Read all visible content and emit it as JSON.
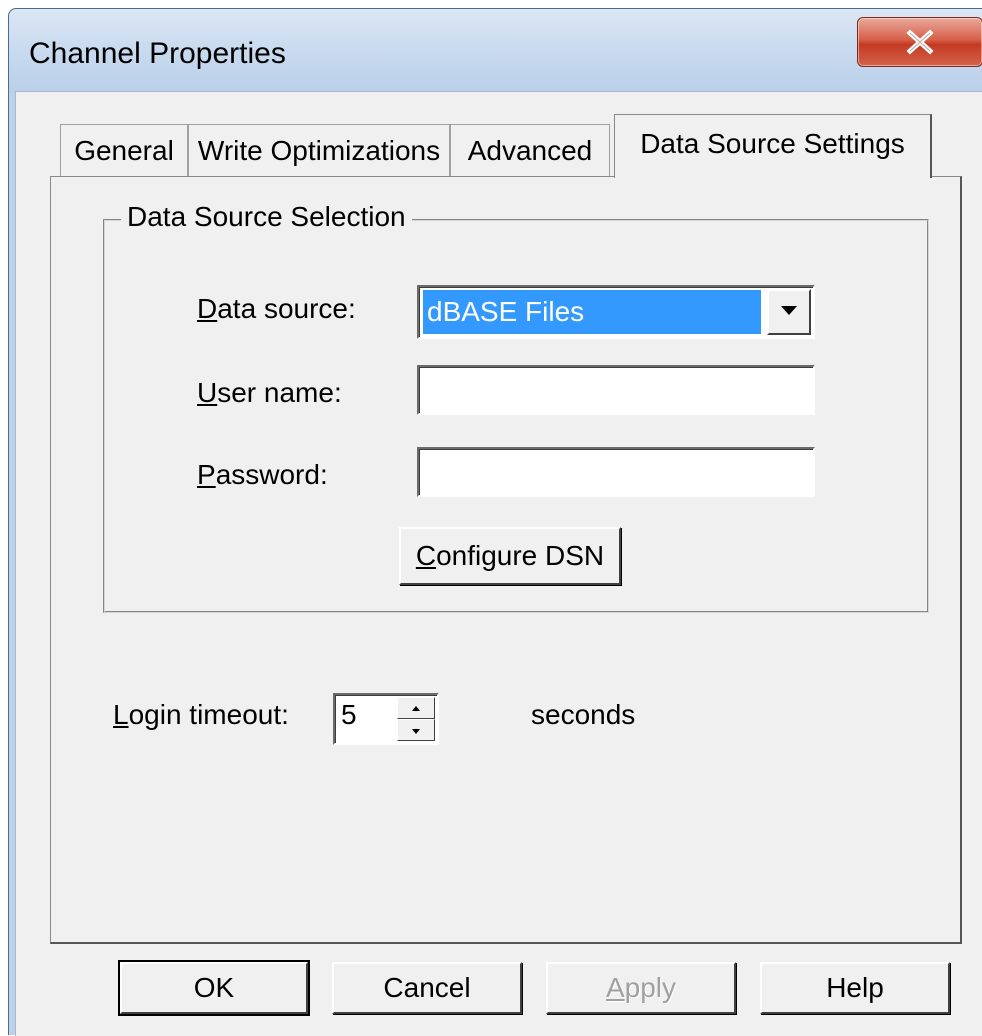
{
  "window": {
    "title": "Channel Properties",
    "close_glyph": "X"
  },
  "tabs": [
    {
      "label": "General",
      "active": false
    },
    {
      "label": "Write Optimizations",
      "active": false
    },
    {
      "label": "Advanced",
      "active": false
    },
    {
      "label": "Data Source Settings",
      "active": true
    }
  ],
  "group": {
    "legend": "Data Source Selection",
    "data_source": {
      "mnemonic": "D",
      "label_rest": "ata source:",
      "value": "dBASE Files"
    },
    "user_name": {
      "mnemonic": "U",
      "label_rest": "ser name:",
      "value": ""
    },
    "password": {
      "mnemonic": "P",
      "label_rest": "assword:",
      "value": ""
    },
    "configure": {
      "mnemonic": "C",
      "label_rest": "onfigure DSN"
    }
  },
  "login_timeout": {
    "mnemonic": "L",
    "label_rest": "ogin timeout:",
    "value": "5",
    "unit": "seconds"
  },
  "buttons": {
    "ok": "OK",
    "cancel": "Cancel",
    "apply_mnemonic": "A",
    "apply_rest": "pply",
    "help": "Help"
  },
  "icons": [
    "close-icon",
    "dropdown-arrow-icon",
    "spin-up-icon",
    "spin-down-icon"
  ],
  "colors": {
    "selection": "#3399ff",
    "close_button": "#c43a23",
    "dialog_face": "#f0f0f0"
  }
}
